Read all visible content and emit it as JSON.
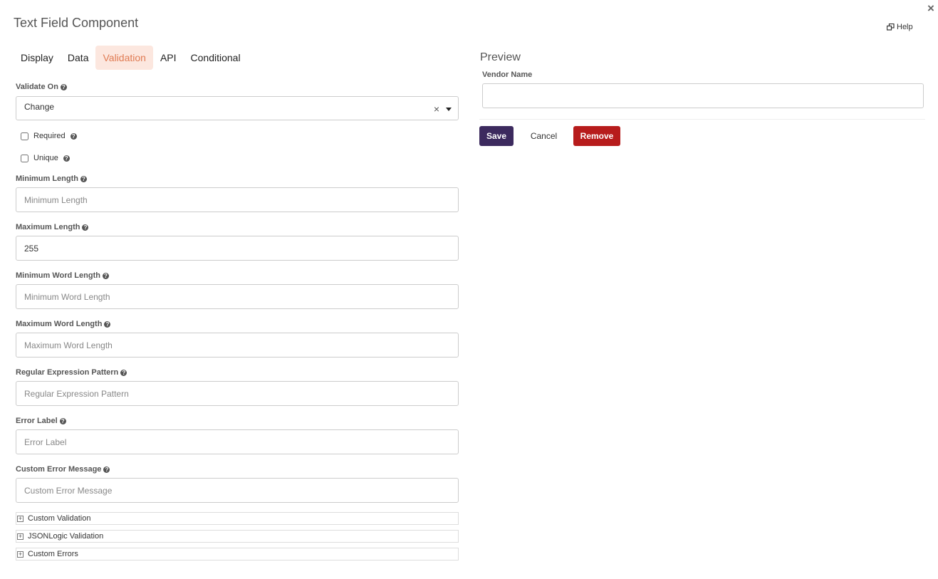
{
  "dialog": {
    "title": "Text Field Component",
    "close_label": "×",
    "help_label": "Help"
  },
  "tabs": [
    {
      "label": "Display",
      "active": false
    },
    {
      "label": "Data",
      "active": false
    },
    {
      "label": "Validation",
      "active": true
    },
    {
      "label": "API",
      "active": false
    },
    {
      "label": "Conditional",
      "active": false
    }
  ],
  "validation": {
    "validate_on": {
      "label": "Validate On",
      "value": "Change"
    },
    "required": {
      "label": "Required",
      "checked": false
    },
    "unique": {
      "label": "Unique",
      "checked": false
    },
    "min_length": {
      "label": "Minimum Length",
      "placeholder": "Minimum Length",
      "value": ""
    },
    "max_length": {
      "label": "Maximum Length",
      "placeholder": "Maximum Length",
      "value": "255"
    },
    "min_word_length": {
      "label": "Minimum Word Length",
      "placeholder": "Minimum Word Length",
      "value": ""
    },
    "max_word_length": {
      "label": "Maximum Word Length",
      "placeholder": "Maximum Word Length",
      "value": ""
    },
    "regex": {
      "label": "Regular Expression Pattern",
      "placeholder": "Regular Expression Pattern",
      "value": ""
    },
    "error_label": {
      "label": "Error Label",
      "placeholder": "Error Label",
      "value": ""
    },
    "custom_error": {
      "label": "Custom Error Message",
      "placeholder": "Custom Error Message",
      "value": ""
    }
  },
  "panels": [
    {
      "label": "Custom Validation"
    },
    {
      "label": "JSONLogic Validation"
    },
    {
      "label": "Custom Errors"
    }
  ],
  "preview": {
    "title": "Preview",
    "field_label": "Vendor Name"
  },
  "actions": {
    "save": "Save",
    "cancel": "Cancel",
    "remove": "Remove"
  },
  "colors": {
    "active_tab_bg": "#fce7df",
    "active_tab_text": "#e07b53",
    "save": "#3c2a5e",
    "remove": "#b71c1c"
  }
}
